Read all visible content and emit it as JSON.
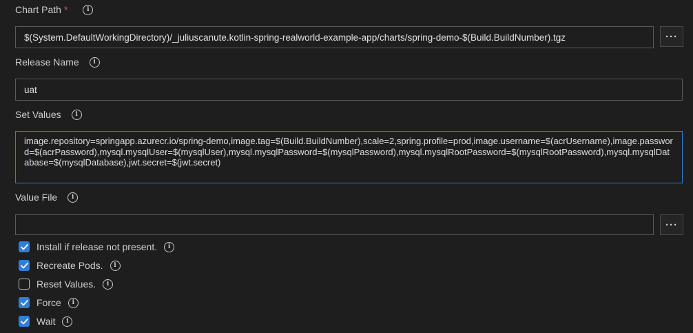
{
  "chart_path": {
    "label": "Chart Path",
    "required_marker": "*",
    "value": "$(System.DefaultWorkingDirectory)/_juliuscanute.kotlin-spring-realworld-example-app/charts/spring-demo-$(Build.BuildNumber).tgz",
    "browse_label": "···"
  },
  "release_name": {
    "label": "Release Name",
    "value": "uat"
  },
  "set_values": {
    "label": "Set Values",
    "value": "image.repository=springapp.azurecr.io/spring-demo,image.tag=$(Build.BuildNumber),scale=2,spring.profile=prod,image.username=$(acrUsername),image.password=$(acrPassword),mysql.mysqlUser=$(mysqlUser),mysql.mysqlPassword=$(mysqlPassword),mysql.mysqlRootPassword=$(mysqlRootPassword),mysql.mysqlDatabase=$(mysqlDatabase),jwt.secret=$(jwt.secret)"
  },
  "value_file": {
    "label": "Value File",
    "value": "",
    "browse_label": "···"
  },
  "options": [
    {
      "label": "Install if release not present.",
      "checked": true
    },
    {
      "label": "Recreate Pods.",
      "checked": true
    },
    {
      "label": "Reset Values.",
      "checked": false
    },
    {
      "label": "Force",
      "checked": true
    },
    {
      "label": "Wait",
      "checked": true
    }
  ],
  "info_glyph": "i",
  "icons": {
    "info": "info-circle-icon",
    "check": "checkmark-icon",
    "browse": "ellipsis-icon"
  },
  "colors": {
    "accent": "#2f7ed8",
    "required": "#f14c4c",
    "background": "#1e1e1e"
  }
}
